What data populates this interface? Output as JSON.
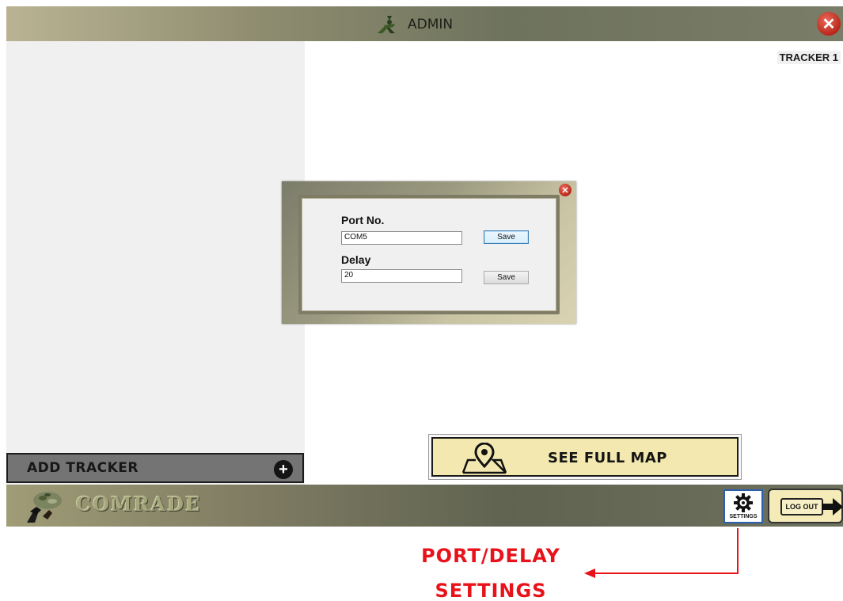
{
  "header": {
    "title": "ADMIN",
    "admin_icon": "admin-soldier-icon",
    "close_icon": "close-icon"
  },
  "tracker": {
    "label": "TRACKER 1"
  },
  "sidebar": {
    "add_tracker_label": "ADD TRACKER",
    "add_icon": "plus-icon"
  },
  "dialog": {
    "close_icon": "close-icon",
    "port": {
      "label": "Port No.",
      "value": "COM5",
      "save_label": "Save"
    },
    "delay": {
      "label": "Delay",
      "value": "20",
      "save_label": "Save"
    }
  },
  "map_button": {
    "label": "SEE FULL MAP",
    "icon": "map-pin-icon"
  },
  "footer": {
    "brand": "COMRADE",
    "logo_icon": "soldier-logo-icon",
    "settings_label": "SETTINGS",
    "settings_icon": "gear-icon",
    "logout_label": "LOG OUT",
    "logout_icon": "exit-arrow-icon"
  },
  "annotation": {
    "line1": "PORT/DELAY",
    "line2": "SETTINGS",
    "color": "#e8121a"
  },
  "colors": {
    "accent_red": "#b8281a",
    "map_button_fill": "#f3e9b0",
    "sidebar_bg": "#f0f0f0"
  }
}
